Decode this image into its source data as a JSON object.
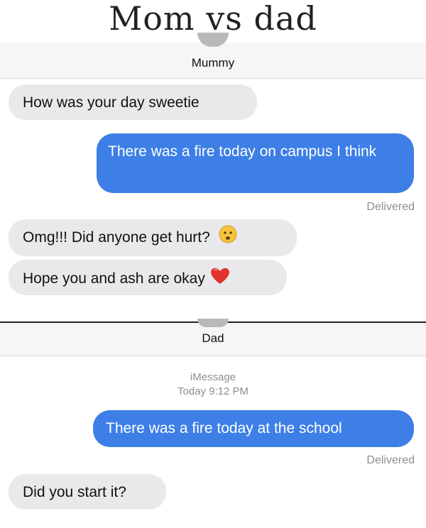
{
  "meme_title": "Mom vs dad",
  "mom_chat": {
    "contact_name": "Mummy",
    "messages": [
      {
        "text": "How was your day sweetie"
      },
      {
        "text": "There was a fire today on campus I think"
      },
      {
        "text": "Omg!!! Did anyone get hurt?"
      },
      {
        "text": "Hope you and ash are okay"
      }
    ],
    "status": "Delivered",
    "emojis": [
      "worried-face-icon",
      "red-heart-icon"
    ]
  },
  "dad_chat": {
    "contact_name": "Dad",
    "service_label": "iMessage",
    "timestamp": "Today 9:12 PM",
    "messages": [
      {
        "text": "There was a fire today at the school"
      },
      {
        "text": "Did you start it?"
      }
    ],
    "status": "Delivered"
  },
  "colors": {
    "incoming_bubble": "#e9e9eb",
    "outgoing_bubble": "#3d7fe6",
    "status_text": "#8e8e93"
  }
}
